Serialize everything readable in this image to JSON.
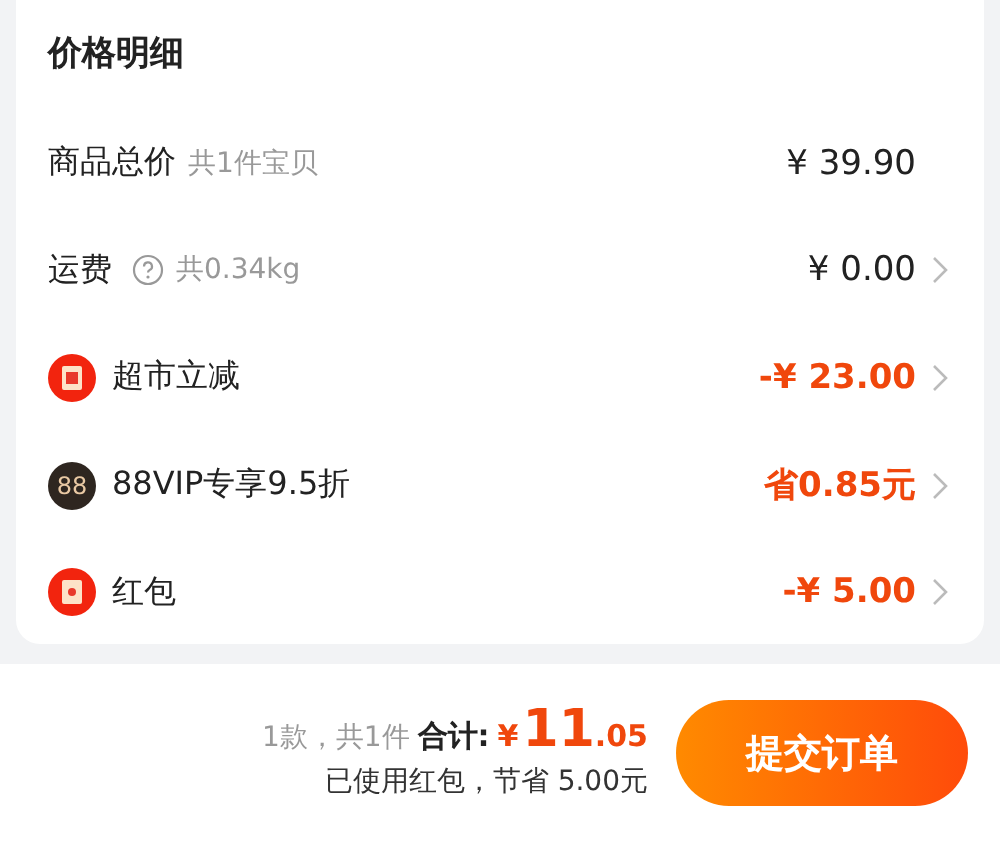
{
  "title": "价格明细",
  "rows": [
    {
      "kind": "plain",
      "label": "商品总价",
      "note": "共1件宝贝",
      "value": "¥ 39.90",
      "highlight": false,
      "arrow": false
    },
    {
      "kind": "help",
      "label": "运费",
      "note": "共0.34kg",
      "value": "¥ 0.00",
      "highlight": false,
      "arrow": true
    },
    {
      "kind": "discount",
      "label": "超市立减",
      "value": "-¥ 23.00",
      "highlight": true,
      "arrow": true
    },
    {
      "kind": "vip",
      "badge": "88",
      "label": "88VIP专享9.5折",
      "value": "省0.85元",
      "highlight": true,
      "arrow": true
    },
    {
      "kind": "redpacket",
      "label": "红包",
      "value": "-¥ 5.00",
      "highlight": true,
      "arrow": true
    }
  ],
  "footer": {
    "count": "1款，共1件",
    "total_label": "合计:",
    "currency": "¥",
    "total_integer": "11",
    "total_decimal": ".05",
    "saving": "已使用红包，节省 5.00元",
    "submit": "提交订单"
  }
}
